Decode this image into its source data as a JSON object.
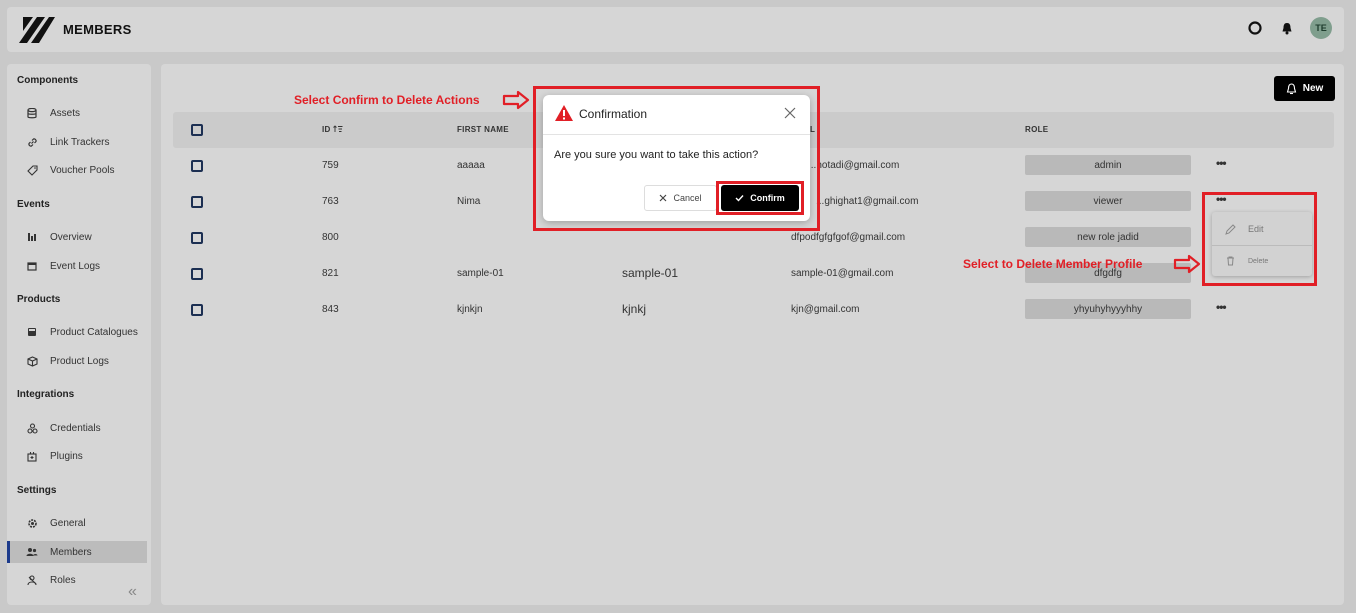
{
  "app": {
    "title": "MEMBERS",
    "avatar_initials": "TE"
  },
  "sidebar": {
    "sections": [
      {
        "title": "Components",
        "items": [
          "Assets",
          "Link Trackers",
          "Voucher Pools"
        ]
      },
      {
        "title": "Events",
        "items": [
          "Overview",
          "Event Logs"
        ]
      },
      {
        "title": "Products",
        "items": [
          "Product Catalogues",
          "Product Logs"
        ]
      },
      {
        "title": "Integrations",
        "items": [
          "Credentials",
          "Plugins"
        ]
      },
      {
        "title": "Settings",
        "items": [
          "General",
          "Members",
          "Roles"
        ]
      }
    ],
    "active_item": "Members",
    "collapse_glyph": "«"
  },
  "toolbar": {
    "new_label": "New"
  },
  "table": {
    "headers": {
      "id": "ID",
      "first_name": "FIRST NAME",
      "email_partial": "L",
      "role": "ROLE"
    },
    "rows": [
      {
        "id": "759",
        "first_name": "aaaaa",
        "last_name": "",
        "email": "...hotadi@gmail.com",
        "role": "admin"
      },
      {
        "id": "763",
        "first_name": "Nima",
        "last_name": "",
        "email": "...ghighat1@gmail.com",
        "role": "viewer"
      },
      {
        "id": "800",
        "first_name": "",
        "last_name": "",
        "email": "dfpodfgfgfgof@gmail.com",
        "role": "new role jadid"
      },
      {
        "id": "821",
        "first_name": "sample-01",
        "last_name": "sample-01",
        "email": "sample-01@gmail.com",
        "role": "dfgdfg"
      },
      {
        "id": "843",
        "first_name": "kjnkjn",
        "last_name": "kjnkj",
        "email": "kjn@gmail.com",
        "role": "yhyuhyhyyyhhy"
      }
    ]
  },
  "row_menu": {
    "edit_label": "Edit",
    "delete_label": "Delete"
  },
  "dialog": {
    "title": "Confirmation",
    "message": "Are you sure you want to take this action?",
    "cancel_label": "Cancel",
    "confirm_label": "Confirm"
  },
  "annotations": {
    "confirm_hint": "Select Confirm to Delete Actions",
    "delete_hint": "Select to Delete Member Profile"
  },
  "colors": {
    "highlight": "#e11f26",
    "primary_button": "#000000",
    "active_nav": "#1d3b8c"
  }
}
